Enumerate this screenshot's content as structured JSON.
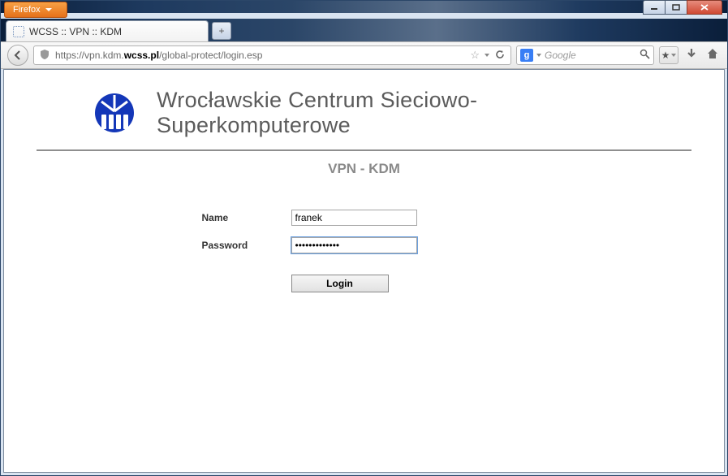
{
  "browser": {
    "name": "Firefox",
    "tab_title": "WCSS :: VPN :: KDM",
    "url_prefix": "https://vpn.kdm.",
    "url_bold": "wcss.pl",
    "url_suffix": "/global-protect/login.esp",
    "search_placeholder": "Google"
  },
  "page": {
    "org_title": "Wrocławskie Centrum Sieciowo-Superkomputerowe",
    "subhead": "VPN - KDM",
    "form": {
      "name_label": "Name",
      "name_value": "franek",
      "password_label": "Password",
      "password_value": "•••••••••••••",
      "login_label": "Login"
    }
  }
}
